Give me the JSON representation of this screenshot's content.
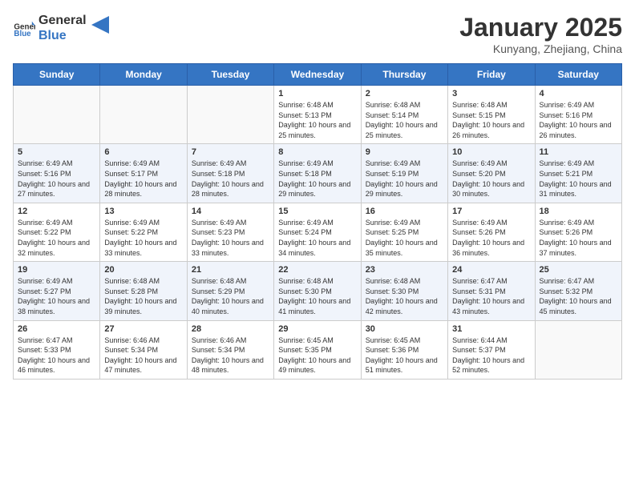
{
  "logo": {
    "general": "General",
    "blue": "Blue"
  },
  "header": {
    "month": "January 2025",
    "location": "Kunyang, Zhejiang, China"
  },
  "weekdays": [
    "Sunday",
    "Monday",
    "Tuesday",
    "Wednesday",
    "Thursday",
    "Friday",
    "Saturday"
  ],
  "weeks": [
    [
      {
        "day": "",
        "info": ""
      },
      {
        "day": "",
        "info": ""
      },
      {
        "day": "",
        "info": ""
      },
      {
        "day": "1",
        "info": "Sunrise: 6:48 AM\nSunset: 5:13 PM\nDaylight: 10 hours and 25 minutes."
      },
      {
        "day": "2",
        "info": "Sunrise: 6:48 AM\nSunset: 5:14 PM\nDaylight: 10 hours and 25 minutes."
      },
      {
        "day": "3",
        "info": "Sunrise: 6:48 AM\nSunset: 5:15 PM\nDaylight: 10 hours and 26 minutes."
      },
      {
        "day": "4",
        "info": "Sunrise: 6:49 AM\nSunset: 5:16 PM\nDaylight: 10 hours and 26 minutes."
      }
    ],
    [
      {
        "day": "5",
        "info": "Sunrise: 6:49 AM\nSunset: 5:16 PM\nDaylight: 10 hours and 27 minutes."
      },
      {
        "day": "6",
        "info": "Sunrise: 6:49 AM\nSunset: 5:17 PM\nDaylight: 10 hours and 28 minutes."
      },
      {
        "day": "7",
        "info": "Sunrise: 6:49 AM\nSunset: 5:18 PM\nDaylight: 10 hours and 28 minutes."
      },
      {
        "day": "8",
        "info": "Sunrise: 6:49 AM\nSunset: 5:18 PM\nDaylight: 10 hours and 29 minutes."
      },
      {
        "day": "9",
        "info": "Sunrise: 6:49 AM\nSunset: 5:19 PM\nDaylight: 10 hours and 29 minutes."
      },
      {
        "day": "10",
        "info": "Sunrise: 6:49 AM\nSunset: 5:20 PM\nDaylight: 10 hours and 30 minutes."
      },
      {
        "day": "11",
        "info": "Sunrise: 6:49 AM\nSunset: 5:21 PM\nDaylight: 10 hours and 31 minutes."
      }
    ],
    [
      {
        "day": "12",
        "info": "Sunrise: 6:49 AM\nSunset: 5:22 PM\nDaylight: 10 hours and 32 minutes."
      },
      {
        "day": "13",
        "info": "Sunrise: 6:49 AM\nSunset: 5:22 PM\nDaylight: 10 hours and 33 minutes."
      },
      {
        "day": "14",
        "info": "Sunrise: 6:49 AM\nSunset: 5:23 PM\nDaylight: 10 hours and 33 minutes."
      },
      {
        "day": "15",
        "info": "Sunrise: 6:49 AM\nSunset: 5:24 PM\nDaylight: 10 hours and 34 minutes."
      },
      {
        "day": "16",
        "info": "Sunrise: 6:49 AM\nSunset: 5:25 PM\nDaylight: 10 hours and 35 minutes."
      },
      {
        "day": "17",
        "info": "Sunrise: 6:49 AM\nSunset: 5:26 PM\nDaylight: 10 hours and 36 minutes."
      },
      {
        "day": "18",
        "info": "Sunrise: 6:49 AM\nSunset: 5:26 PM\nDaylight: 10 hours and 37 minutes."
      }
    ],
    [
      {
        "day": "19",
        "info": "Sunrise: 6:49 AM\nSunset: 5:27 PM\nDaylight: 10 hours and 38 minutes."
      },
      {
        "day": "20",
        "info": "Sunrise: 6:48 AM\nSunset: 5:28 PM\nDaylight: 10 hours and 39 minutes."
      },
      {
        "day": "21",
        "info": "Sunrise: 6:48 AM\nSunset: 5:29 PM\nDaylight: 10 hours and 40 minutes."
      },
      {
        "day": "22",
        "info": "Sunrise: 6:48 AM\nSunset: 5:30 PM\nDaylight: 10 hours and 41 minutes."
      },
      {
        "day": "23",
        "info": "Sunrise: 6:48 AM\nSunset: 5:30 PM\nDaylight: 10 hours and 42 minutes."
      },
      {
        "day": "24",
        "info": "Sunrise: 6:47 AM\nSunset: 5:31 PM\nDaylight: 10 hours and 43 minutes."
      },
      {
        "day": "25",
        "info": "Sunrise: 6:47 AM\nSunset: 5:32 PM\nDaylight: 10 hours and 45 minutes."
      }
    ],
    [
      {
        "day": "26",
        "info": "Sunrise: 6:47 AM\nSunset: 5:33 PM\nDaylight: 10 hours and 46 minutes."
      },
      {
        "day": "27",
        "info": "Sunrise: 6:46 AM\nSunset: 5:34 PM\nDaylight: 10 hours and 47 minutes."
      },
      {
        "day": "28",
        "info": "Sunrise: 6:46 AM\nSunset: 5:34 PM\nDaylight: 10 hours and 48 minutes."
      },
      {
        "day": "29",
        "info": "Sunrise: 6:45 AM\nSunset: 5:35 PM\nDaylight: 10 hours and 49 minutes."
      },
      {
        "day": "30",
        "info": "Sunrise: 6:45 AM\nSunset: 5:36 PM\nDaylight: 10 hours and 51 minutes."
      },
      {
        "day": "31",
        "info": "Sunrise: 6:44 AM\nSunset: 5:37 PM\nDaylight: 10 hours and 52 minutes."
      },
      {
        "day": "",
        "info": ""
      }
    ]
  ]
}
